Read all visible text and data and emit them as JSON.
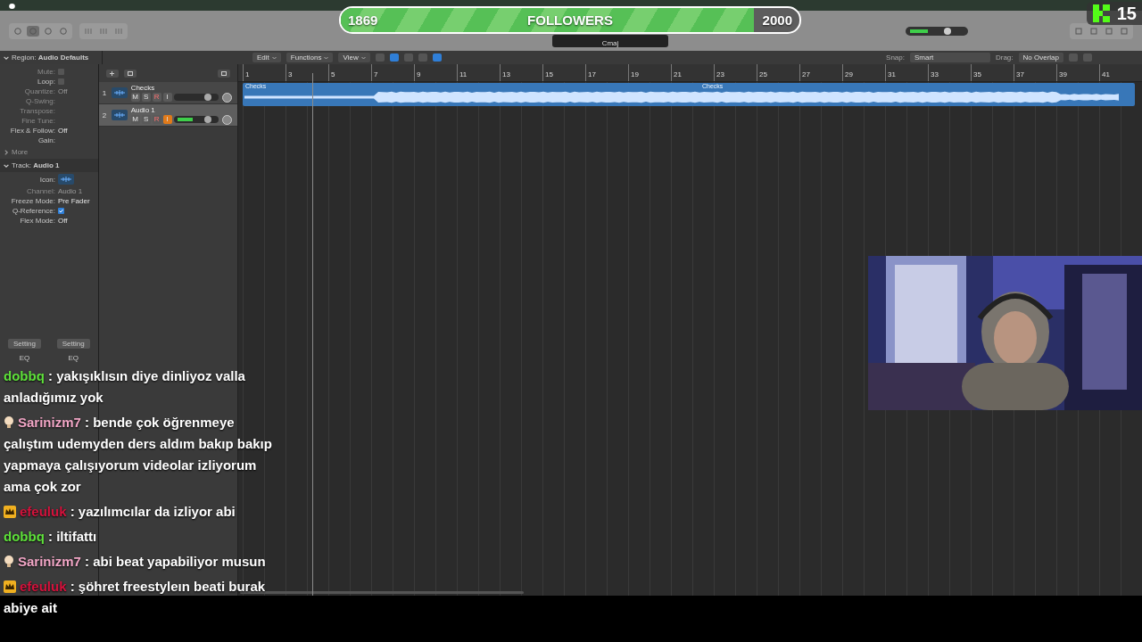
{
  "followers": {
    "current": "1869",
    "label": "FOLLOWERS",
    "goal": "2000",
    "level": 0.9
  },
  "viewers": {
    "count": "15"
  },
  "control_bar": {
    "key": "Cmaj",
    "master_volume": {
      "level": 0.7
    }
  },
  "toolbar": {
    "menus": [
      "Edit",
      "Functions",
      "View"
    ],
    "snap": {
      "label": "Snap:",
      "value": "Smart"
    },
    "drag": {
      "label": "Drag:",
      "value": "No Overlap"
    }
  },
  "inspector": {
    "region_header": {
      "label": "Region:",
      "value": "Audio Defaults",
      "expanded": true
    },
    "region_rows": [
      {
        "kind": "checkbox",
        "label": "Mute:",
        "checked": false,
        "disabled": true
      },
      {
        "kind": "checkbox",
        "label": "Loop:",
        "checked": false,
        "disabled": false
      },
      {
        "kind": "value",
        "label": "Quantize:",
        "value": "Off",
        "disabled": true
      },
      {
        "kind": "label",
        "label": "Q-Swing:",
        "disabled": true
      },
      {
        "kind": "label",
        "label": "Transpose:",
        "disabled": true
      },
      {
        "kind": "label",
        "label": "Fine Tune:",
        "disabled": true
      },
      {
        "kind": "value",
        "label": "Flex & Follow:",
        "value": "Off",
        "disabled": false
      },
      {
        "kind": "label",
        "label": "Gain:",
        "disabled": false
      }
    ],
    "more": "More",
    "track_header": {
      "label": "Track:",
      "value": "Audio 1",
      "expanded": true
    },
    "track_rows": [
      {
        "kind": "icon",
        "label": "Icon:"
      },
      {
        "kind": "value",
        "label": "Channel:",
        "value": "Audio 1",
        "disabled": true
      },
      {
        "kind": "value",
        "label": "Freeze Mode:",
        "value": "Pre Fader",
        "disabled": false
      },
      {
        "kind": "checkbox",
        "label": "Q-Reference:",
        "checked": true,
        "disabled": false
      },
      {
        "kind": "value",
        "label": "Flex Mode:",
        "value": "Off",
        "disabled": false
      }
    ],
    "mixer": [
      {
        "setting": "Setting",
        "eq": "EQ"
      },
      {
        "setting": "Setting",
        "eq": "EQ"
      }
    ]
  },
  "ruler": [
    "1",
    "3",
    "5",
    "7",
    "9",
    "11",
    "13",
    "15",
    "17",
    "19",
    "21",
    "23",
    "25",
    "27",
    "29",
    "31",
    "33",
    "35",
    "37",
    "39",
    "41"
  ],
  "tracks": [
    {
      "number": "1",
      "name": "Checks",
      "buttons": [
        "M",
        "S",
        "R",
        "I"
      ],
      "selected": false,
      "input_monitor": false
    },
    {
      "number": "2",
      "name": "Audio 1",
      "buttons": [
        "M",
        "S",
        "R",
        "I"
      ],
      "selected": true,
      "input_monitor": true,
      "level": 0.35
    }
  ],
  "region": {
    "labels": [
      "Checks",
      "Checks"
    ]
  },
  "chat": [
    {
      "kind": "plain",
      "user": "dobbq",
      "color": "#5ee03a",
      "text": ": yakışıklısın diye dinliyoz valla anladığımız yok"
    },
    {
      "kind": "bulb",
      "user": "Sarinizm7",
      "color": "#f2a6c6",
      "text": ": bende çok öğrenmeye çalıştım udemyden ders aldım bakıp bakıp yapmaya çalışıyorum videolar izliyorum ama çok zor"
    },
    {
      "kind": "crown",
      "user": "efeuluk",
      "color": "#d4123c",
      "text": ": yazılımcılar da izliyor abi"
    },
    {
      "kind": "plain",
      "user": "dobbq",
      "color": "#5ee03a",
      "text": ": iltifattı"
    },
    {
      "kind": "bulb",
      "user": "Sarinizm7",
      "color": "#f2a6c6",
      "text": ": abi beat yapabiliyor musun"
    },
    {
      "kind": "crown",
      "user": "efeuluk",
      "color": "#d4123c",
      "text": ": şöhret freestyleın beati burak abiye ait"
    }
  ]
}
